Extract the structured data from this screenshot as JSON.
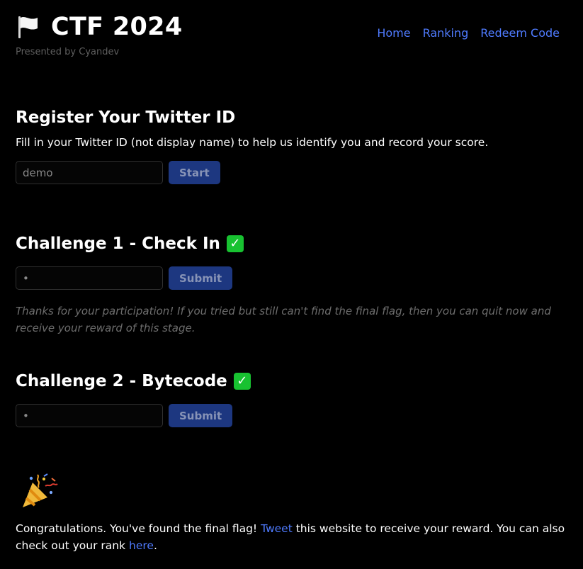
{
  "header": {
    "title": "CTF 2024",
    "subtitle": "Presented by Cyandev",
    "flag_icon": "flag-icon"
  },
  "nav": {
    "items": [
      "Home",
      "Ranking",
      "Redeem Code"
    ],
    "color": "#4f7bff"
  },
  "register": {
    "heading": "Register Your Twitter ID",
    "description": "Fill in your Twitter ID (not display name) to help us identify you and record your score.",
    "input_value": "demo",
    "button_label": "Start"
  },
  "challenges": [
    {
      "heading": "Challenge 1 - Check In",
      "status_icon": "check-icon",
      "input_value": "•",
      "button_label": "Submit",
      "note": "Thanks for your participation! If you tried but still can't find the final flag, then you can quit now and receive your reward of this stage."
    },
    {
      "heading": "Challenge 2 - Bytecode",
      "status_icon": "check-icon",
      "input_value": "•",
      "button_label": "Submit"
    }
  ],
  "final": {
    "icon": "party-popper-icon",
    "text_before_link": "Congratulations. You've found the final flag! ",
    "link_tweet": "Tweet",
    "text_middle": " this website to receive your reward. You can also check out your rank ",
    "link_here": "here",
    "text_end": "."
  },
  "colors": {
    "background": "#000000",
    "accent": "#4f7bff",
    "button_bg": "#1d3780",
    "success": "#18c231"
  }
}
